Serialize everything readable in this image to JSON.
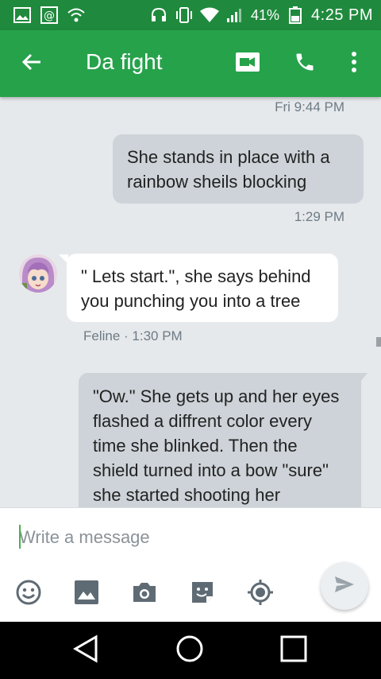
{
  "status_bar": {
    "battery": "41%",
    "time": "4:25 PM",
    "icons": [
      "image-icon",
      "at-icon",
      "wifi-calling-icon",
      "headset-icon",
      "vibrate-icon",
      "wifi-icon",
      "signal-icon",
      "battery-icon"
    ]
  },
  "app_bar": {
    "title": "Da fight",
    "icons": [
      "back-arrow-icon",
      "video-call-icon",
      "phone-icon",
      "more-vert-icon"
    ],
    "color": "#26a24b"
  },
  "messages": {
    "ts_top": "Fri 9:44 PM",
    "m1": {
      "text": "She stands in place with a rainbow sheils blocking",
      "time": "1:29 PM"
    },
    "m2": {
      "text": "\" Lets start.\", she says behind you punching you into a tree",
      "meta": "Feline · 1:30 PM"
    },
    "m3": {
      "text": "\"Ow.\" She gets up and her eyes flashed a diffrent color every time she blinked. Then the shield turned into a bow \"sure\" she started shooting her"
    }
  },
  "composer": {
    "placeholder": "Write a message",
    "value": "",
    "tools": [
      "emoji-icon",
      "gallery-icon",
      "camera-icon",
      "sticker-icon",
      "location-icon"
    ],
    "send_icon": "send-icon"
  },
  "nav_bar": {
    "icons": [
      "nav-back-icon",
      "nav-home-icon",
      "nav-recents-icon"
    ]
  }
}
